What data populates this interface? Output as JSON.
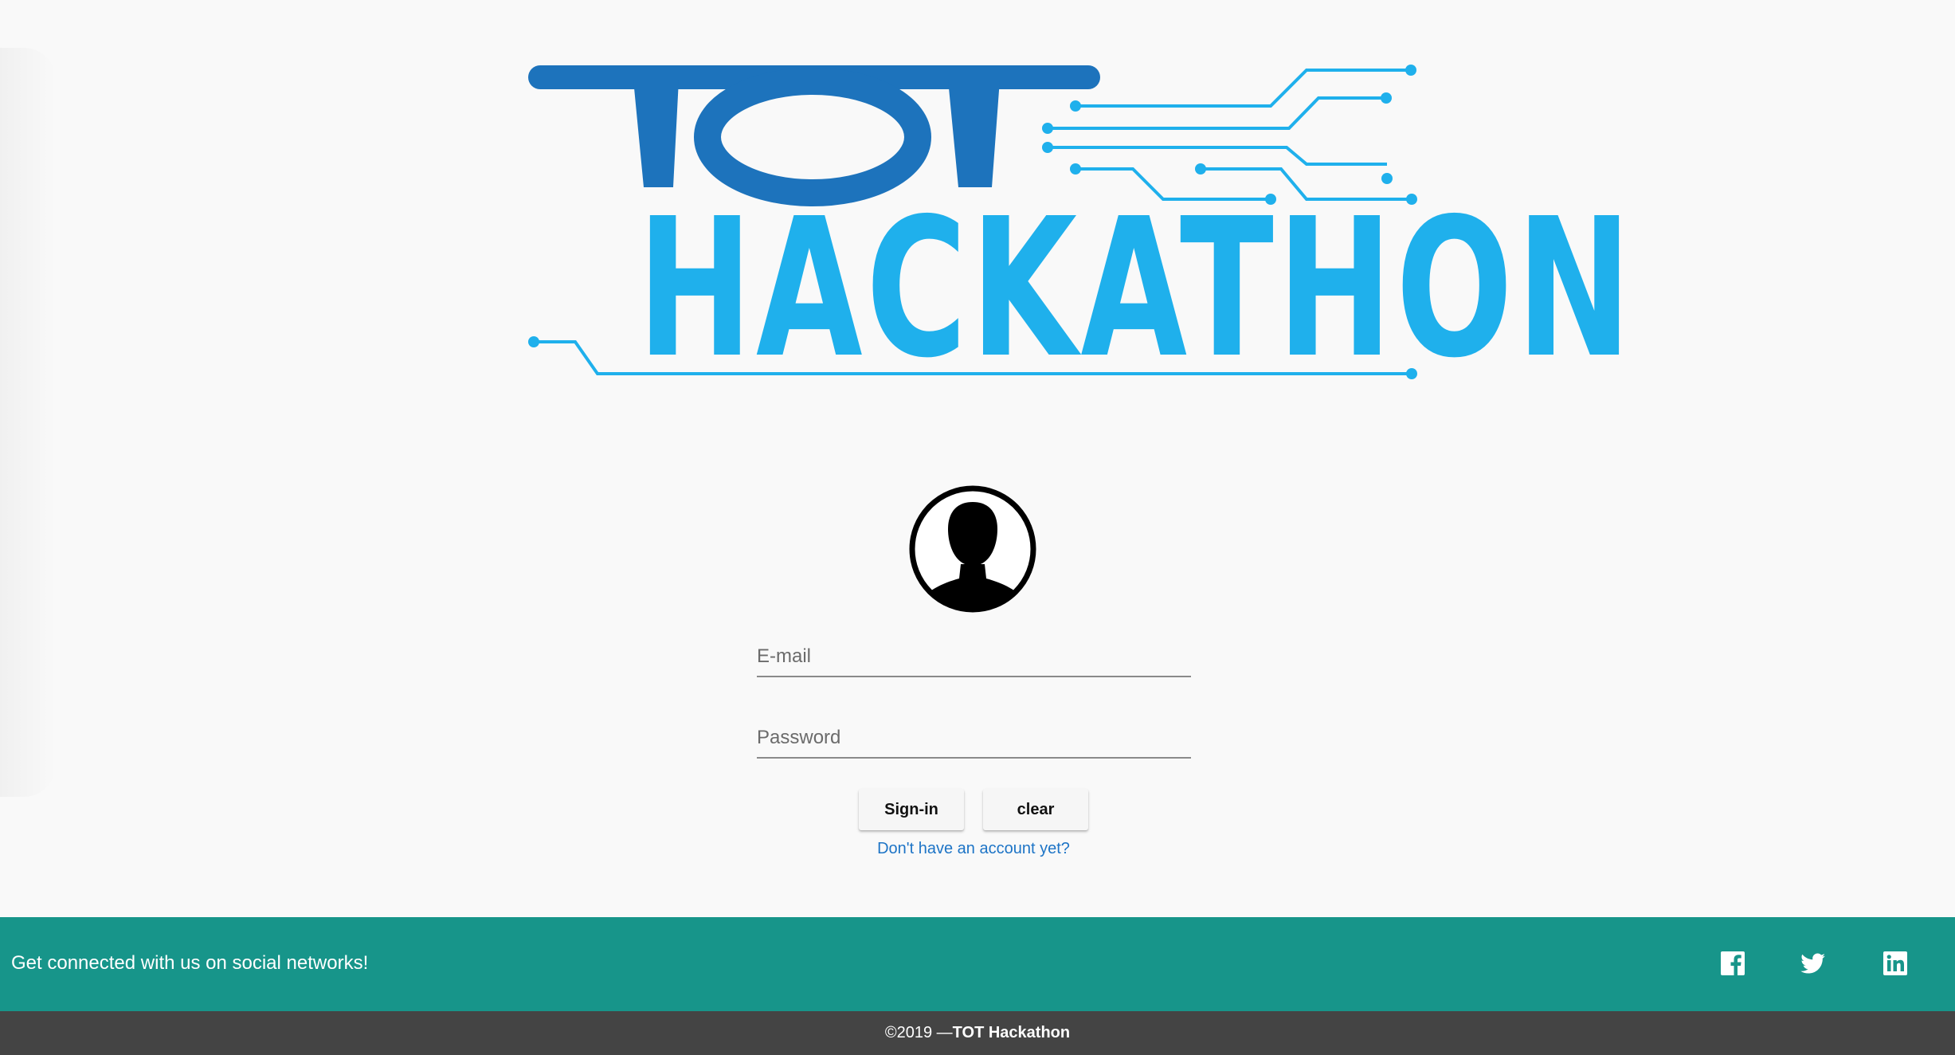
{
  "brand": {
    "logo_line1": "TOT",
    "logo_line2": "HACKATHON",
    "dark_blue": "#1d73bc",
    "light_blue": "#1fb0ec"
  },
  "login": {
    "avatar_icon": "user-silhouette-icon",
    "email_placeholder": "E-mail",
    "email_value": "",
    "password_placeholder": "Password",
    "password_value": "",
    "signin_label": "Sign-in",
    "clear_label": "clear",
    "signup_link_label": "Don't have an account yet?"
  },
  "footer": {
    "social_text": "Get connected with us on social networks!",
    "social_icons": [
      "facebook-icon",
      "twitter-icon",
      "linkedin-icon"
    ],
    "social_color": "#17958a",
    "copyright_prefix": "©2019 —",
    "copyright_name": "TOT Hackathon",
    "copyright_color": "#444444"
  }
}
